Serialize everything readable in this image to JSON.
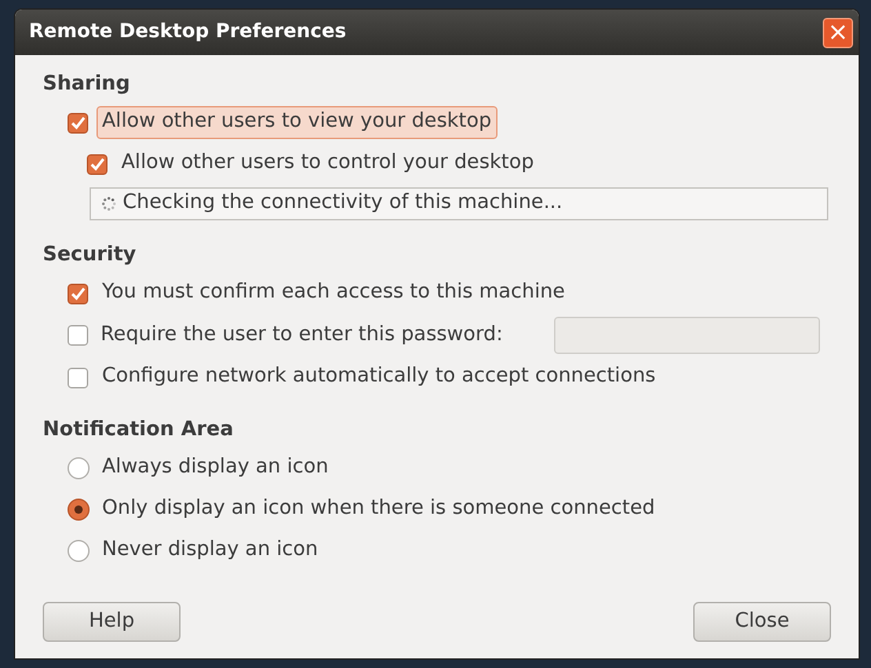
{
  "window": {
    "title": "Remote Desktop Preferences",
    "close": "×"
  },
  "sections": [
    {
      "title": "Sharing",
      "items": [
        {
          "kind": "checkbox",
          "label": "Allow other users to view your desktop",
          "checked": true,
          "focused": true
        },
        {
          "kind": "subcheckbox",
          "label": "Allow other users to control your desktop",
          "checked": true,
          "focused": false
        },
        {
          "kind": "status",
          "label": "Checking the connectivity of this machine..."
        }
      ]
    },
    {
      "title": "Security",
      "items": [
        {
          "kind": "checkbox",
          "label": "You must confirm each access to this machine",
          "checked": true,
          "focused": false
        },
        {
          "kind": "password",
          "label": "Require the user to enter this password:",
          "checked": false
        },
        {
          "kind": "checkbox",
          "label": "Configure network automatically to accept connections",
          "checked": false,
          "focused": false
        }
      ]
    },
    {
      "title": "Notification Area",
      "items": [
        {
          "kind": "radio",
          "label": "Always display an icon",
          "selected": false
        },
        {
          "kind": "radio",
          "label": "Only display an icon when there is someone connected",
          "selected": true
        },
        {
          "kind": "radio",
          "label": "Never display an icon",
          "selected": false
        }
      ]
    }
  ],
  "buttons": [
    "Help",
    "Close"
  ]
}
